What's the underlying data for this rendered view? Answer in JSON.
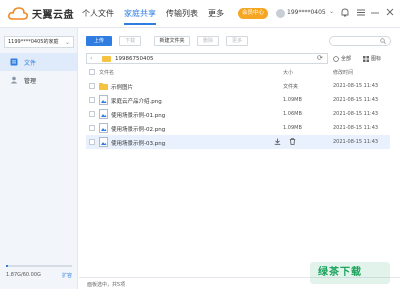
{
  "app": {
    "logo_text": "天翼云盘"
  },
  "nav": {
    "tabs": [
      {
        "label": "个人文件",
        "active": false
      },
      {
        "label": "家庭共享",
        "active": true
      },
      {
        "label": "传输列表",
        "active": false
      },
      {
        "label": "更多",
        "active": false
      }
    ]
  },
  "header": {
    "member_badge": "会员中心",
    "username": "199****0405"
  },
  "sidebar": {
    "account_select": "1199****0405的家庭",
    "items": [
      {
        "label": "文件",
        "icon": "file-icon",
        "active": true
      },
      {
        "label": "管理",
        "icon": "member-icon",
        "active": false
      }
    ],
    "quota_text": "1.87G/60.00G",
    "quota_fraction": 0.031,
    "expand_label": "扩容"
  },
  "toolbar": {
    "upload": "上传",
    "download": "下载",
    "new_folder": "新建文件夹",
    "delete": "删除",
    "more": "更多",
    "search_placeholder": ""
  },
  "path": {
    "current": "19986750405"
  },
  "view_controls": {
    "filter": "全部",
    "layout": "图标"
  },
  "table": {
    "columns": [
      "文件名",
      "大小",
      "修改时间"
    ],
    "rows": [
      {
        "name": "示例图片",
        "type": "folder",
        "size": "文件夹",
        "time": "2021-08-15 11:43"
      },
      {
        "name": "家庭云产品介绍.png",
        "type": "image",
        "size": "1.09MB",
        "time": "2021-08-15 11:43"
      },
      {
        "name": "使用场景示例-01.png",
        "type": "image",
        "size": "1.06MB",
        "time": "2021-08-15 11:43"
      },
      {
        "name": "使用场景示例-02.png",
        "type": "image",
        "size": "1.09MB",
        "time": "2021-08-15 11:43"
      },
      {
        "name": "使用场景示例-03.png",
        "type": "image",
        "size": "",
        "time": "2021-08-15 11:43"
      }
    ]
  },
  "status": {
    "text": "面板选中，共5项"
  },
  "watermark": {
    "text": "绿茶下载"
  },
  "colors": {
    "accent": "#2f7de1",
    "folder": "#f5c242",
    "badge": "#f5a623"
  }
}
